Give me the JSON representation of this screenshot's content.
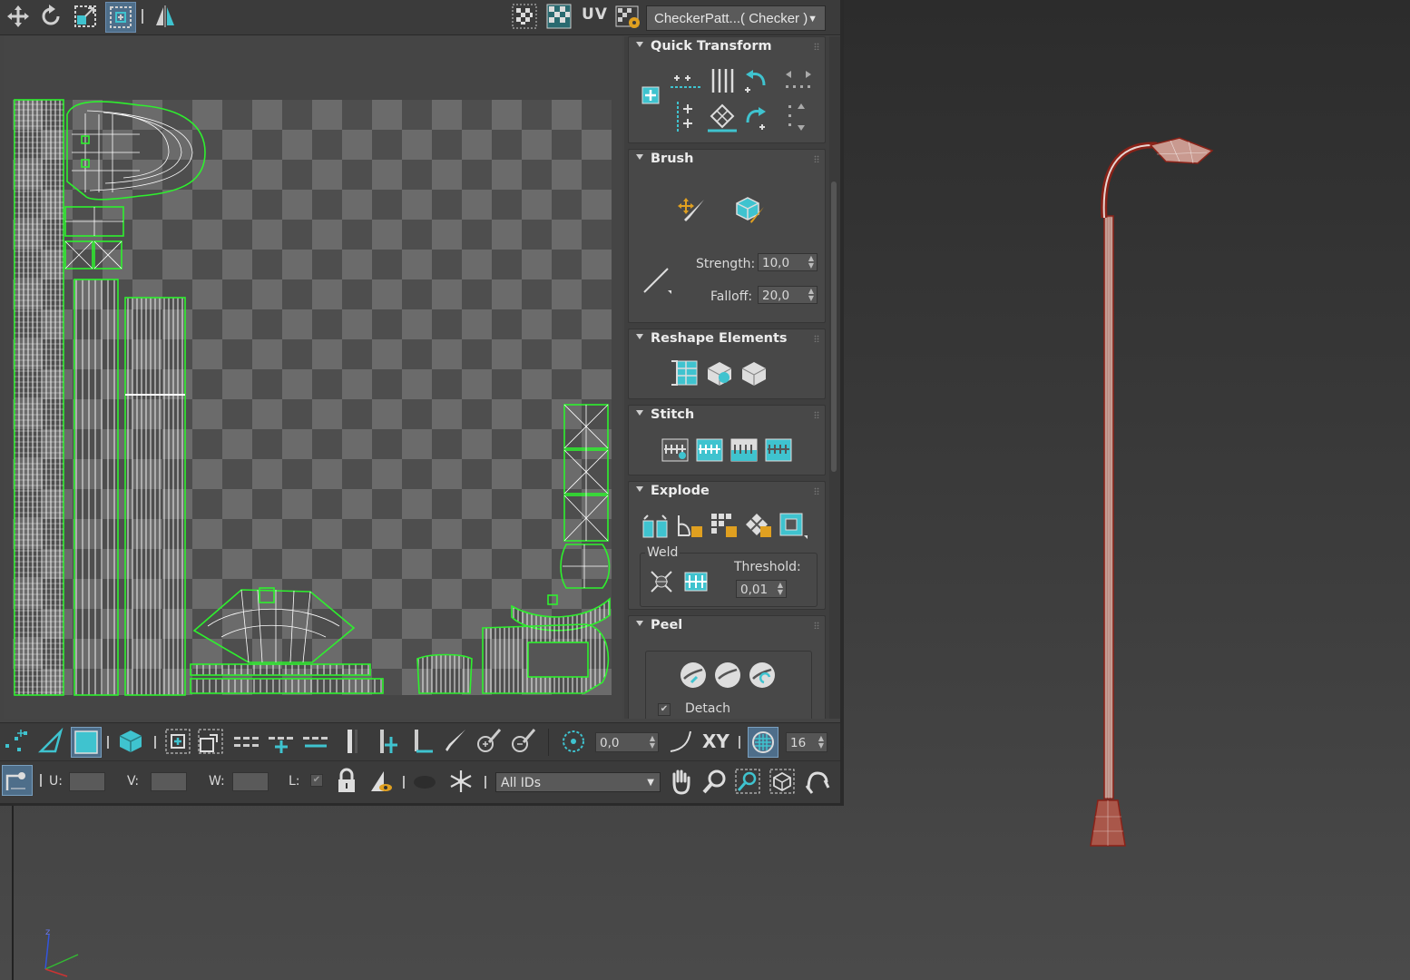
{
  "toolbar": {
    "uv_label": "UV",
    "texture_map": "CheckerPatt...( Checker )",
    "tools": [
      "move-icon",
      "rotate-icon",
      "scale-icon",
      "freeform-icon",
      "mirror-icon"
    ]
  },
  "rollouts": {
    "quick_transform": {
      "title": "Quick Transform"
    },
    "brush": {
      "title": "Brush",
      "strength_label": "Strength:",
      "strength_value": "10,0",
      "falloff_label": "Falloff:",
      "falloff_value": "20,0"
    },
    "reshape": {
      "title": "Reshape Elements"
    },
    "stitch": {
      "title": "Stitch"
    },
    "explode": {
      "title": "Explode",
      "weld_label": "Weld",
      "threshold_label": "Threshold:",
      "threshold_value": "0,01"
    },
    "peel": {
      "title": "Peel",
      "detach_label": "Detach",
      "detach_checked": true
    }
  },
  "bottom_toolbar": {
    "soft_value": "0,0",
    "xy_label": "XY",
    "grid_value": "16",
    "u_label": "U:",
    "v_label": "V:",
    "w_label": "W:",
    "l_label": "L:",
    "ids_select": "All IDs"
  },
  "colors": {
    "uv_wire": "#2ef02e",
    "mesh_wire": "#ffffff",
    "model_wire": "#9a2a20",
    "accent": "#3fc3cf",
    "panel": "#484848"
  }
}
